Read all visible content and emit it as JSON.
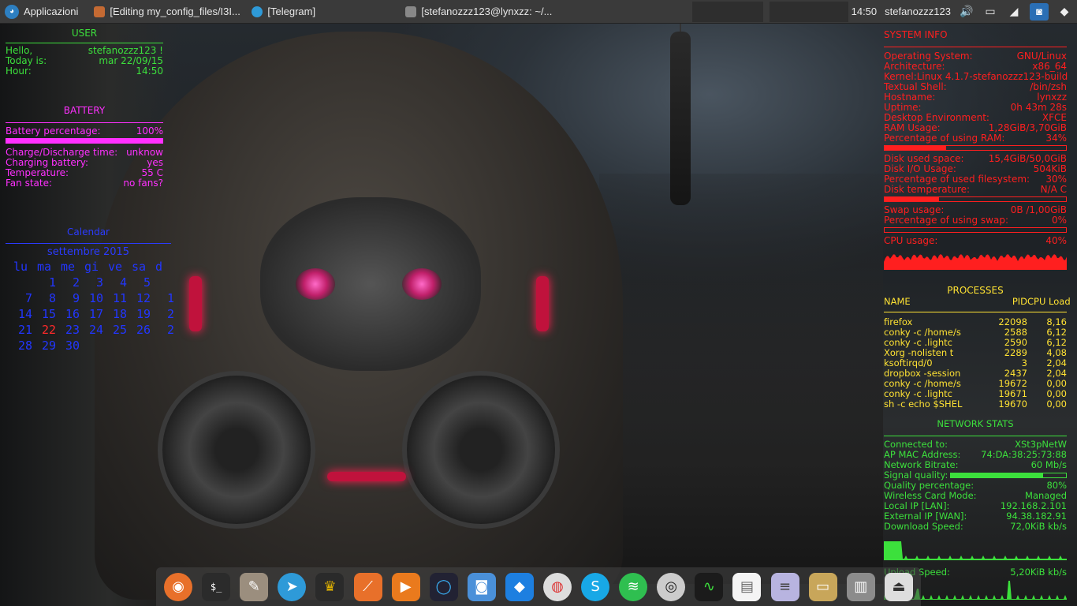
{
  "panel": {
    "menu_label": "Applicazioni",
    "tasks": [
      {
        "label": "[Editing my_config_files/I3I..."
      },
      {
        "label": "[Telegram]"
      },
      {
        "label": "[stefanozzz123@lynxzz: ~/..."
      }
    ],
    "clock": "14:50",
    "user": "stefanozzz123"
  },
  "user_section": {
    "header": "USER",
    "hello_label": "Hello,",
    "hello_value": "stefanozzz123 !",
    "today_label": "Today is:",
    "today_value": "mar 22/09/15",
    "hour_label": "Hour:",
    "hour_value": "14:50"
  },
  "battery": {
    "header": "BATTERY",
    "percentage_label": "Battery percentage:",
    "percentage_value": "100%",
    "percentage_fraction": 1.0,
    "rows": [
      {
        "label": "Charge/Discharge time:",
        "value": "unknow"
      },
      {
        "label": "Charging battery:",
        "value": "yes"
      },
      {
        "label": "Temperature:",
        "value": "55 C"
      },
      {
        "label": "Fan state:",
        "value": "no fans?"
      }
    ]
  },
  "calendar": {
    "header": "Calendar",
    "month": "settembre 2015",
    "weekdays": [
      "lu",
      "ma",
      "me",
      "gi",
      "ve",
      "sa",
      "d"
    ],
    "weeks": [
      [
        "",
        "1",
        "2",
        "3",
        "4",
        "5",
        ""
      ],
      [
        "7",
        "8",
        "9",
        "10",
        "11",
        "12",
        "1"
      ],
      [
        "14",
        "15",
        "16",
        "17",
        "18",
        "19",
        "2"
      ],
      [
        "21",
        "22",
        "23",
        "24",
        "25",
        "26",
        "2"
      ],
      [
        "28",
        "29",
        "30",
        "",
        "",
        "",
        ""
      ]
    ],
    "today": "22"
  },
  "system": {
    "header": "SYSTEM INFO",
    "rows": [
      {
        "label": "Operating System:",
        "value": "GNU/Linux"
      },
      {
        "label": "Architecture:",
        "value": "x86_64"
      },
      {
        "label": "Kernel:",
        "value": "Linux 4.1.7-stefanozzz123-build"
      },
      {
        "label": "Textual Shell:",
        "value": "/bin/zsh"
      },
      {
        "label": "Hostname:",
        "value": "lynxzz"
      },
      {
        "label": "Uptime:",
        "value": "0h 43m 28s"
      },
      {
        "label": "Desktop Environment:",
        "value": "XFCE"
      },
      {
        "label": "RAM Usage:",
        "value": "1,28GiB/3,70GiB"
      },
      {
        "label": "Percentage of using RAM:",
        "value": "34%"
      }
    ],
    "ram_fraction": 0.34,
    "disk_rows": [
      {
        "label": "Disk used space:",
        "value": "15,4GiB/50,0GiB"
      },
      {
        "label": "Disk I/O Usage:",
        "value": "504KiB"
      },
      {
        "label": "Percentage of used filesystem:",
        "value": "30%"
      },
      {
        "label": "Disk temperature:",
        "value": "N/A C"
      }
    ],
    "disk_fraction": 0.3,
    "swap_rows": [
      {
        "label": "Swap usage:",
        "value": "0B  /1,00GiB"
      },
      {
        "label": "Percentage of using swap:",
        "value": "0%"
      }
    ],
    "swap_fraction": 0.0,
    "cpu_label": "CPU usage:",
    "cpu_value": "40%"
  },
  "processes": {
    "header": "PROCESSES",
    "columns": [
      "NAME",
      "PID",
      "CPU Load"
    ],
    "rows": [
      {
        "name": "firefox",
        "pid": "22098",
        "cpu": "8,16"
      },
      {
        "name": "conky -c /home/s",
        "pid": "2588",
        "cpu": "6,12"
      },
      {
        "name": "conky -c .lightc",
        "pid": "2590",
        "cpu": "6,12"
      },
      {
        "name": "Xorg -nolisten t",
        "pid": "2289",
        "cpu": "4,08"
      },
      {
        "name": "ksoftirqd/0",
        "pid": "3",
        "cpu": "2,04"
      },
      {
        "name": "dropbox -session",
        "pid": "2437",
        "cpu": "2,04"
      },
      {
        "name": "conky -c /home/s",
        "pid": "19672",
        "cpu": "0,00"
      },
      {
        "name": "conky -c .lightc",
        "pid": "19671",
        "cpu": "0,00"
      },
      {
        "name": "sh -c echo $SHEL",
        "pid": "19670",
        "cpu": "0,00"
      }
    ]
  },
  "network": {
    "header": "NETWORK STATS",
    "rows": [
      {
        "label": "Connected to:",
        "value": "XSt3pNetW"
      },
      {
        "label": "AP MAC Address:",
        "value": "74:DA:38:25:73:88"
      },
      {
        "label": "Network Bitrate:",
        "value": "60 Mb/s"
      }
    ],
    "signal_label": "Signal quality:",
    "signal_fraction": 0.8,
    "rows2": [
      {
        "label": "Quality percentage:",
        "value": "80%"
      },
      {
        "label": "Wireless Card Mode:",
        "value": "Managed"
      },
      {
        "label": "Local IP [LAN]:",
        "value": "192.168.2.101"
      },
      {
        "label": "External IP [WAN]:",
        "value": "94.38.182.91"
      },
      {
        "label": "Download Speed:",
        "value": "72,0KiB kb/s"
      }
    ],
    "upload_label": "Upload Speed:",
    "upload_value": "5,20KiB kb/s"
  },
  "colors": {
    "green": "#3ce03c",
    "magenta": "#ff30ff",
    "blue": "#2b3bff",
    "red": "#ff1f1f",
    "yellow": "#ffe233"
  },
  "dock": {
    "icons": [
      "firefox-icon",
      "terminal-icon",
      "gimp-icon",
      "telegram-icon",
      "game-icon",
      "app-icon",
      "media-player-icon",
      "simplenote-icon",
      "screenshot-icon",
      "dropbox-icon",
      "chromium-icon",
      "skype-icon",
      "spotify-icon",
      "webcam-icon",
      "system-monitor-icon",
      "text-editor-icon",
      "notes-icon",
      "folder-icon",
      "trash-icon",
      "eject-icon"
    ]
  }
}
